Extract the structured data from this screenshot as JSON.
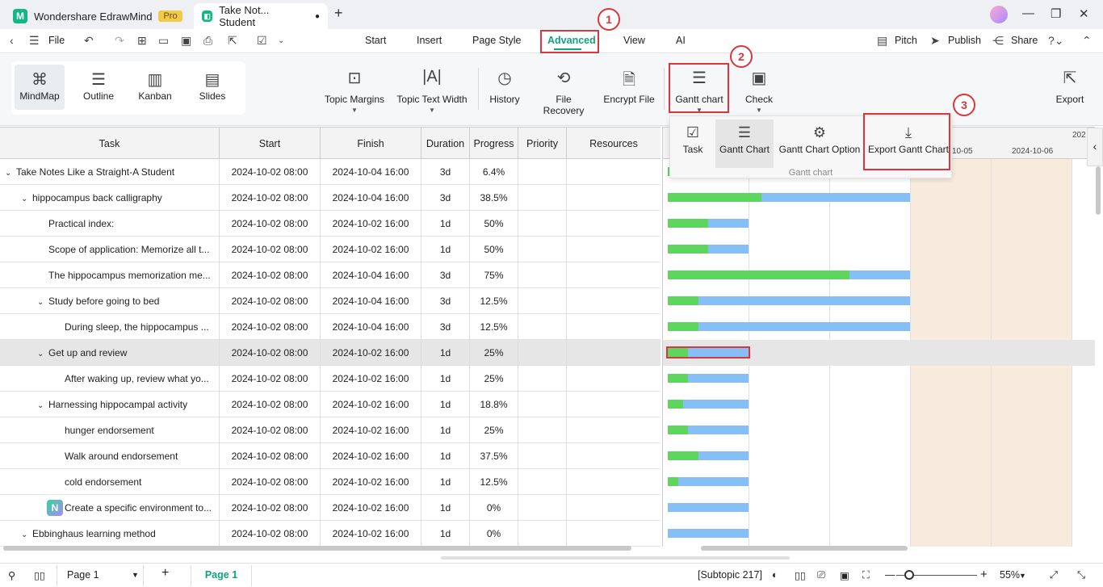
{
  "titlebar": {
    "app_name": "Wondershare EdrawMind",
    "pro_badge": "Pro",
    "doc_tab": "Take Not... Student"
  },
  "menubar": {
    "file": "File",
    "tabs": [
      "Start",
      "Insert",
      "Page Style",
      "Advanced",
      "View",
      "AI"
    ],
    "active_tab": "Advanced",
    "pitch": "Pitch",
    "publish": "Publish",
    "share": "Share"
  },
  "ribbon": {
    "views": [
      "MindMap",
      "Outline",
      "Kanban",
      "Slides"
    ],
    "selected_view": "MindMap",
    "topic_margins": "Topic Margins",
    "topic_text_width": "Topic Text Width",
    "history": "History",
    "file_recovery": "File Recovery",
    "encrypt_file": "Encrypt File",
    "gantt_chart": "Gantt chart",
    "check": "Check",
    "export": "Export"
  },
  "dropdown": {
    "task": "Task",
    "gantt_chart": "Gantt Chart",
    "gantt_chart_option": "Gantt Chart Option",
    "export_gantt_chart": "Export Gantt Chart",
    "group_label": "Gantt chart"
  },
  "annotations": [
    "1",
    "2",
    "3"
  ],
  "table": {
    "headers": [
      "Task",
      "Start",
      "Finish",
      "Duration",
      "Progress",
      "Priority",
      "Resources"
    ],
    "rows": [
      {
        "task": "Take Notes Like a Straight-A Student",
        "start": "2024-10-02 08:00",
        "finish": "2024-10-04 16:00",
        "duration": "3d",
        "progress": "6.4%"
      },
      {
        "task": "hippocampus back calligraphy",
        "start": "2024-10-02 08:00",
        "finish": "2024-10-04 16:00",
        "duration": "3d",
        "progress": "38.5%"
      },
      {
        "task": "Practical index:",
        "start": "2024-10-02 08:00",
        "finish": "2024-10-02 16:00",
        "duration": "1d",
        "progress": "50%"
      },
      {
        "task": "Scope of application: Memorize all t...",
        "start": "2024-10-02 08:00",
        "finish": "2024-10-02 16:00",
        "duration": "1d",
        "progress": "50%"
      },
      {
        "task": "The hippocampus memorization me...",
        "start": "2024-10-02 08:00",
        "finish": "2024-10-04 16:00",
        "duration": "3d",
        "progress": "75%"
      },
      {
        "task": "Study before going to bed",
        "start": "2024-10-02 08:00",
        "finish": "2024-10-04 16:00",
        "duration": "3d",
        "progress": "12.5%"
      },
      {
        "task": "During sleep, the hippocampus ...",
        "start": "2024-10-02 08:00",
        "finish": "2024-10-04 16:00",
        "duration": "3d",
        "progress": "12.5%"
      },
      {
        "task": "Get up and review",
        "start": "2024-10-02 08:00",
        "finish": "2024-10-02 16:00",
        "duration": "1d",
        "progress": "25%"
      },
      {
        "task": "After waking up, review what yo...",
        "start": "2024-10-02 08:00",
        "finish": "2024-10-02 16:00",
        "duration": "1d",
        "progress": "25%"
      },
      {
        "task": "Harnessing hippocampal activity",
        "start": "2024-10-02 08:00",
        "finish": "2024-10-02 16:00",
        "duration": "1d",
        "progress": "18.8%"
      },
      {
        "task": "hunger endorsement",
        "start": "2024-10-02 08:00",
        "finish": "2024-10-02 16:00",
        "duration": "1d",
        "progress": "25%"
      },
      {
        "task": "Walk around endorsement",
        "start": "2024-10-02 08:00",
        "finish": "2024-10-02 16:00",
        "duration": "1d",
        "progress": "37.5%"
      },
      {
        "task": "cold endorsement",
        "start": "2024-10-02 08:00",
        "finish": "2024-10-02 16:00",
        "duration": "1d",
        "progress": "12.5%"
      },
      {
        "task": "Create a specific environment to...",
        "start": "2024-10-02 08:00",
        "finish": "2024-10-02 16:00",
        "duration": "1d",
        "progress": "0%"
      },
      {
        "task": "Ebbinghaus learning method",
        "start": "2024-10-02 08:00",
        "finish": "2024-10-02 16:00",
        "duration": "1d",
        "progress": "0%"
      }
    ]
  },
  "gantt": {
    "date_labels": [
      "10-05",
      "2024-10-06",
      "202"
    ],
    "bars": [
      {
        "days": 3,
        "progress": 0.064
      },
      {
        "days": 3,
        "progress": 0.385
      },
      {
        "days": 1,
        "progress": 0.5
      },
      {
        "days": 1,
        "progress": 0.5
      },
      {
        "days": 3,
        "progress": 0.75
      },
      {
        "days": 3,
        "progress": 0.125
      },
      {
        "days": 3,
        "progress": 0.125
      },
      {
        "days": 1,
        "progress": 0.25
      },
      {
        "days": 1,
        "progress": 0.25
      },
      {
        "days": 1,
        "progress": 0.188
      },
      {
        "days": 1,
        "progress": 0.25
      },
      {
        "days": 1,
        "progress": 0.375
      },
      {
        "days": 1,
        "progress": 0.125
      },
      {
        "days": 1,
        "progress": 0
      },
      {
        "days": 1,
        "progress": 0
      }
    ]
  },
  "statusbar": {
    "page_select": "Page 1",
    "page_tab": "Page 1",
    "subtopic": "[Subtopic 217]",
    "zoom": "55%"
  }
}
